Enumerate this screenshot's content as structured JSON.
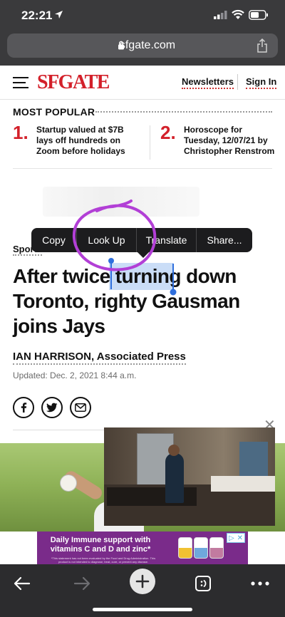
{
  "status_bar": {
    "time": "22:21"
  },
  "browser": {
    "url": "sfgate.com"
  },
  "site": {
    "logo": "SFGATE",
    "nav": {
      "newsletters": "Newsletters",
      "sign_in": "Sign In"
    }
  },
  "most_popular": {
    "title": "MOST POPULAR",
    "items": [
      {
        "number": "1.",
        "text": "Startup valued at $7B lays off hundreds on Zoom before holidays"
      },
      {
        "number": "2.",
        "text": "Horoscope for Tuesday, 12/07/21 by Christopher Renstrom"
      }
    ]
  },
  "context_menu": {
    "items": [
      "Copy",
      "Look Up",
      "Translate",
      "Share..."
    ]
  },
  "article": {
    "section": "Sports",
    "headline": "After twice turning down Toronto, righty Gausman joins Jays",
    "author": "IAN HARRISON, Associated Press",
    "updated": "Updated: Dec. 2, 2021 8:44 a.m."
  },
  "ad": {
    "text": "Daily Immune support with vitamins C and D and zinc*",
    "fine_print": "*This statement has not been evaluated by the Food and Drug Administration. This product is not intended to diagnose, treat, cure, or prevent any disease."
  },
  "colors": {
    "brand_red": "#d3202a",
    "selection": "#5a96e6",
    "annotation": "#b23fd6",
    "ad_purple": "#7a2b8a"
  }
}
